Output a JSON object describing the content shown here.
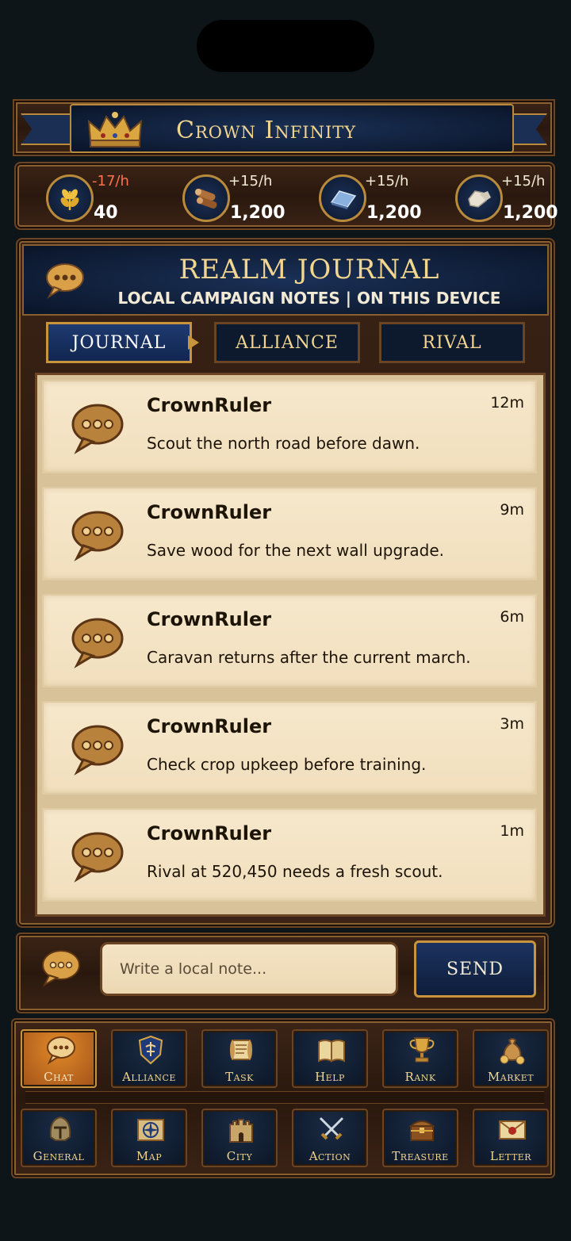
{
  "app": {
    "title": "Crown Infinity"
  },
  "colors": {
    "gold": "#f2d58e",
    "negative_rate": "#ff7050",
    "active_nav": "#e08a28",
    "navy": "#1a3056"
  },
  "resources": [
    {
      "icon": "wheat-icon",
      "rate": "-17/h",
      "value": "40",
      "negative": true
    },
    {
      "icon": "wood-logs-icon",
      "rate": "+15/h",
      "value": "1,200"
    },
    {
      "icon": "iron-ingot-icon",
      "rate": "+15/h",
      "value": "1,200"
    },
    {
      "icon": "stone-icon",
      "rate": "+15/h",
      "value": "1,200"
    }
  ],
  "journal": {
    "title": "REALM JOURNAL",
    "subtitle": "LOCAL CAMPAIGN NOTES | ON THIS DEVICE",
    "tabs": [
      {
        "label": "JOURNAL",
        "active": true
      },
      {
        "label": "ALLIANCE"
      },
      {
        "label": "RIVAL"
      }
    ],
    "messages": [
      {
        "user": "CrownRuler",
        "time": "12m",
        "text": "Scout the north road before dawn."
      },
      {
        "user": "CrownRuler",
        "time": "9m",
        "text": "Save wood for the next wall upgrade."
      },
      {
        "user": "CrownRuler",
        "time": "6m",
        "text": "Caravan returns after the current march."
      },
      {
        "user": "CrownRuler",
        "time": "3m",
        "text": "Check crop upkeep before training."
      },
      {
        "user": "CrownRuler",
        "time": "1m",
        "text": "Rival at 520,450 needs a fresh scout."
      }
    ]
  },
  "composer": {
    "placeholder": "Write a local note...",
    "send_label": "SEND"
  },
  "nav": {
    "row1": [
      {
        "label": "Chat",
        "icon": "chat-bubble-icon",
        "active": true
      },
      {
        "label": "Alliance",
        "icon": "alliance-shield-icon"
      },
      {
        "label": "Task",
        "icon": "scroll-icon"
      },
      {
        "label": "Help",
        "icon": "book-icon"
      },
      {
        "label": "Rank",
        "icon": "trophy-icon"
      },
      {
        "label": "Market",
        "icon": "coin-bag-icon"
      }
    ],
    "row2": [
      {
        "label": "General",
        "icon": "helmet-icon"
      },
      {
        "label": "Map",
        "icon": "compass-map-icon"
      },
      {
        "label": "City",
        "icon": "castle-icon"
      },
      {
        "label": "Action",
        "icon": "crossed-swords-icon"
      },
      {
        "label": "Treasure",
        "icon": "chest-icon"
      },
      {
        "label": "Letter",
        "icon": "sealed-letter-icon"
      }
    ]
  }
}
